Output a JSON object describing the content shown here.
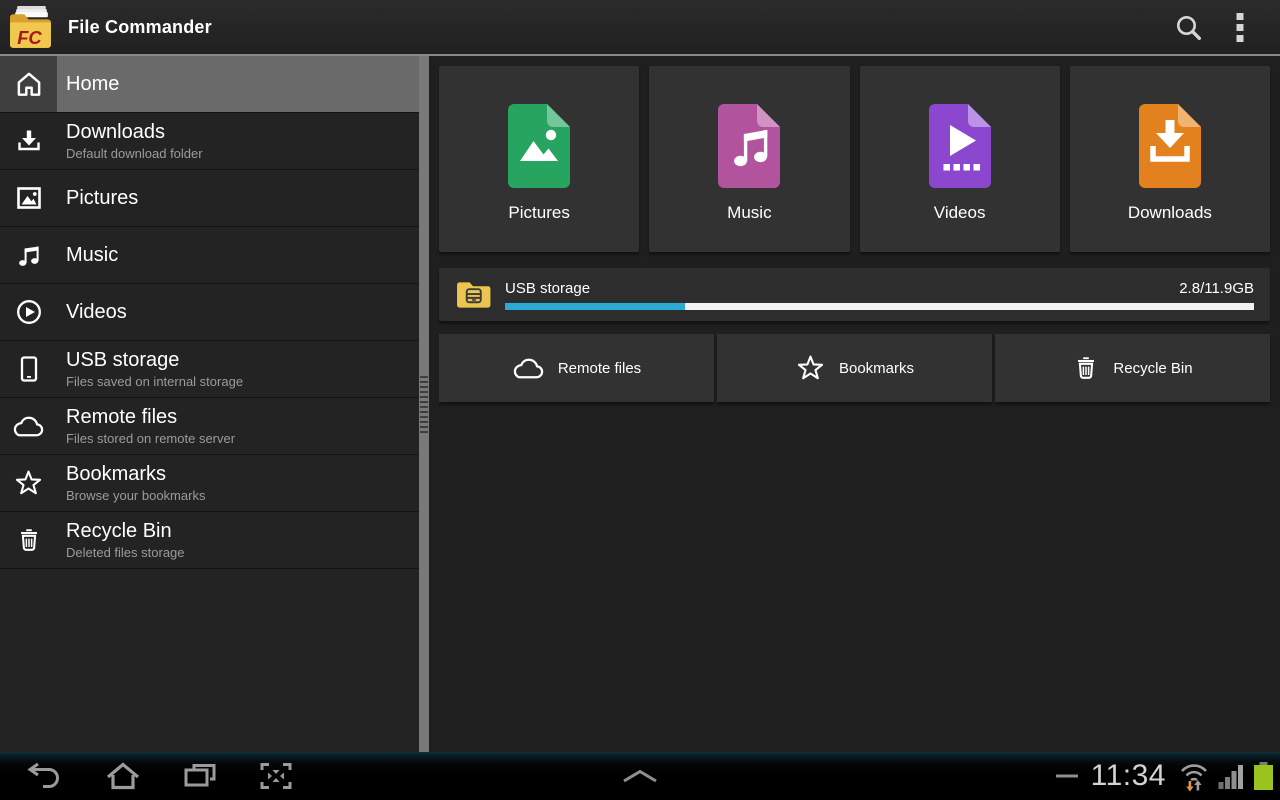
{
  "action_bar": {
    "title": "File Commander",
    "logo_text": "FC"
  },
  "sidebar": {
    "items": [
      {
        "label": "Home",
        "subtitle": "",
        "icon": "home-icon",
        "selected": true
      },
      {
        "label": "Downloads",
        "subtitle": "Default download folder",
        "icon": "download-icon",
        "selected": false
      },
      {
        "label": "Pictures",
        "subtitle": "",
        "icon": "pictures-icon",
        "selected": false
      },
      {
        "label": "Music",
        "subtitle": "",
        "icon": "music-icon",
        "selected": false
      },
      {
        "label": "Videos",
        "subtitle": "",
        "icon": "videos-icon",
        "selected": false
      },
      {
        "label": "USB storage",
        "subtitle": "Files saved on internal storage",
        "icon": "usb-storage-icon",
        "selected": false
      },
      {
        "label": "Remote files",
        "subtitle": "Files stored on remote server",
        "icon": "cloud-icon",
        "selected": false
      },
      {
        "label": "Bookmarks",
        "subtitle": "Browse your bookmarks",
        "icon": "star-icon",
        "selected": false
      },
      {
        "label": "Recycle Bin",
        "subtitle": "Deleted files storage",
        "icon": "trash-icon",
        "selected": false
      }
    ]
  },
  "main": {
    "categories": [
      {
        "label": "Pictures",
        "color": "#27A45F",
        "fold_color": "#74C79B",
        "icon": "pictures-file-icon"
      },
      {
        "label": "Music",
        "color": "#B1549D",
        "fold_color": "#D093C4",
        "icon": "music-file-icon"
      },
      {
        "label": "Videos",
        "color": "#8B48CF",
        "fold_color": "#BA93E6",
        "icon": "videos-file-icon"
      },
      {
        "label": "Downloads",
        "color": "#E2811D",
        "fold_color": "#F0B370",
        "icon": "download-file-icon"
      }
    ],
    "storage": {
      "label": "USB storage",
      "usage": "2.8/11.9GB",
      "percent_used": 24,
      "bar_fill_color": "#2BABD4",
      "bar_track_color": "#F2F2F2",
      "icon": "usb-folder-icon"
    },
    "shortcuts": [
      {
        "label": "Remote files",
        "icon": "cloud-icon"
      },
      {
        "label": "Bookmarks",
        "icon": "star-icon"
      },
      {
        "label": "Recycle Bin",
        "icon": "trash-icon"
      }
    ]
  },
  "system_bar": {
    "time": "11:34",
    "battery_color": "#9AC31F",
    "wifi_arrow_color": "#E09932"
  }
}
